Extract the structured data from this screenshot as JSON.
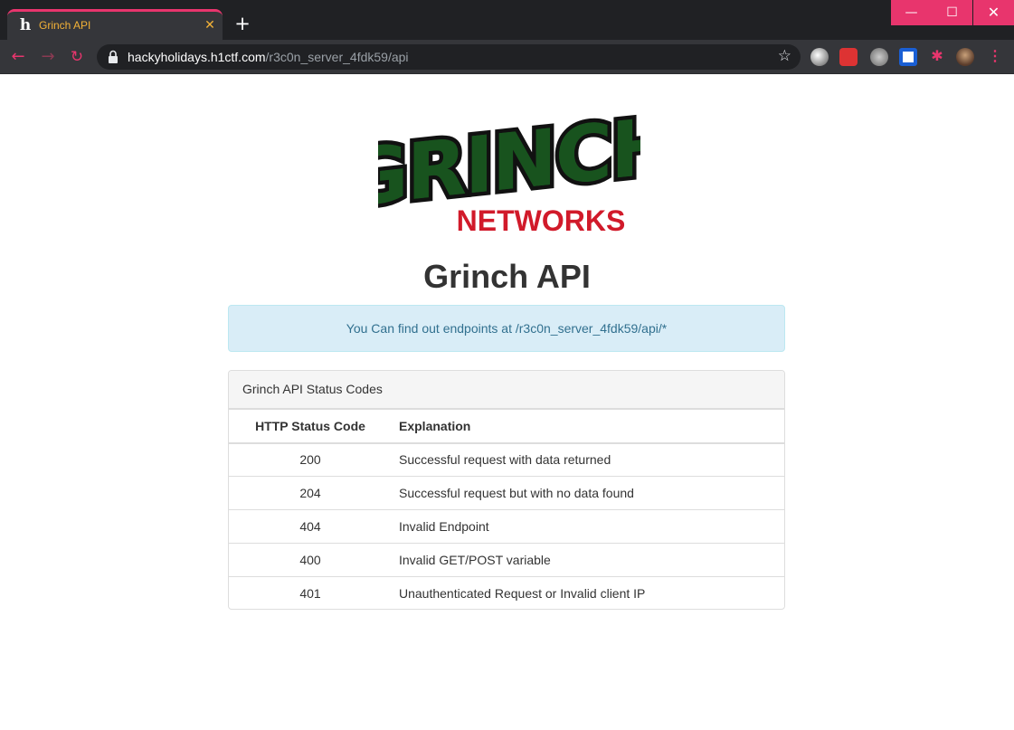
{
  "browser": {
    "tab_title": "Grinch API",
    "tab_favicon": "h",
    "tab_close": "✕",
    "new_tab": "+",
    "url_host": "hackyholidays.h1ctf.com",
    "url_path": "/r3c0n_server_4fdk59/api",
    "window_controls": {
      "minimize": "—",
      "maximize": "☐",
      "close": "✕"
    },
    "nav": {
      "back": "←",
      "forward": "→",
      "reload": "↻"
    },
    "bookmark_icon": "☆",
    "extensions": [
      "globe-extension-icon",
      "santa-extension-icon",
      "gear-extension-icon",
      "shield-extension-icon",
      "puzzle-extensions-icon",
      "profile-avatar"
    ],
    "accent_color": "#e8356d"
  },
  "page": {
    "logo": {
      "top_word": "GRINCH",
      "bottom_word": "NETWORKS",
      "colors": {
        "green": "#1f8a2a",
        "red": "#d11a2a",
        "black": "#111111"
      }
    },
    "title": "Grinch API",
    "alert_text": "You Can find out endpoints at /r3c0n_server_4fdk59/api/*",
    "panel": {
      "heading": "Grinch API Status Codes",
      "columns": [
        "HTTP Status Code",
        "Explanation"
      ],
      "rows": [
        {
          "code": "200",
          "explanation": "Successful request with data returned"
        },
        {
          "code": "204",
          "explanation": "Successful request but with no data found"
        },
        {
          "code": "404",
          "explanation": "Invalid Endpoint"
        },
        {
          "code": "400",
          "explanation": "Invalid GET/POST variable"
        },
        {
          "code": "401",
          "explanation": "Unauthenticated Request or Invalid client IP"
        }
      ]
    }
  }
}
